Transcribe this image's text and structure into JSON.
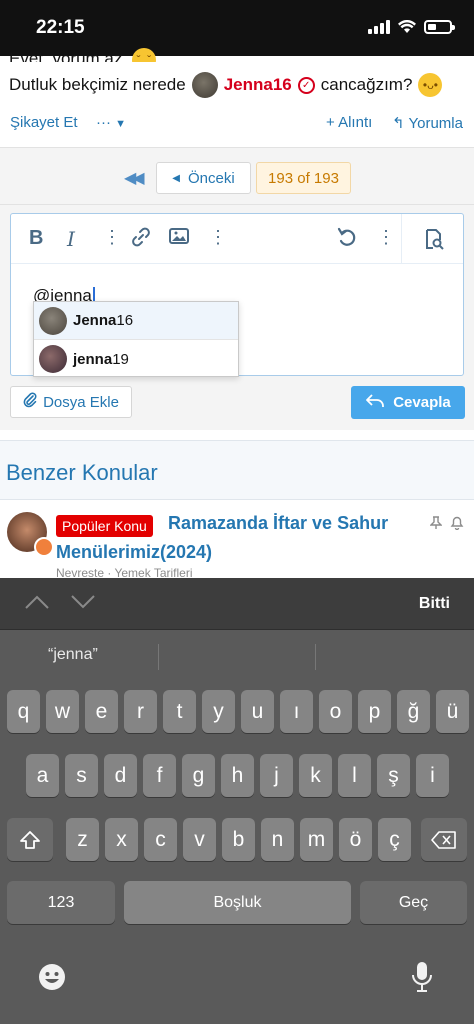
{
  "status_bar": {
    "time": "22:15",
    "battery_level": 0.4
  },
  "post": {
    "partial_line": "Evet, yorum az.",
    "line_text_before": "Dutluk bekçimiz nerede",
    "mention_user": "Jenna16",
    "line_text_after": "cancağzım?",
    "actions": {
      "report": "Şikayet Et",
      "more": "···",
      "quote": "+ Alıntı",
      "reply": "Yorumla"
    }
  },
  "pagination": {
    "prev": "Önceki",
    "current": "193 of 193"
  },
  "editor": {
    "text": "@jenna",
    "suggestions": [
      {
        "bold": "Jenna",
        "rest": "16"
      },
      {
        "bold": "jenna",
        "rest": "19"
      }
    ],
    "attach_label": "Dosya Ekle",
    "submit_label": "Cevapla"
  },
  "similar": {
    "title": "Benzer Konular",
    "thread": {
      "badge": "Popüler Konu",
      "title_line1": "Ramazanda İftar ve Sahur",
      "title_line2": "Menülerimiz(2024)",
      "meta": "Nevreste · Yemek Tarifleri"
    }
  },
  "keyboard": {
    "done": "Bitti",
    "prediction": "“jenna”",
    "row1": [
      "q",
      "w",
      "e",
      "r",
      "t",
      "y",
      "u",
      "ı",
      "o",
      "p",
      "ğ",
      "ü"
    ],
    "row2": [
      "a",
      "s",
      "d",
      "f",
      "g",
      "h",
      "j",
      "k",
      "l",
      "ş",
      "i"
    ],
    "row3": [
      "z",
      "x",
      "c",
      "v",
      "b",
      "n",
      "m",
      "ö",
      "ç"
    ],
    "numbers": "123",
    "space": "Boşluk",
    "go": "Geç"
  }
}
